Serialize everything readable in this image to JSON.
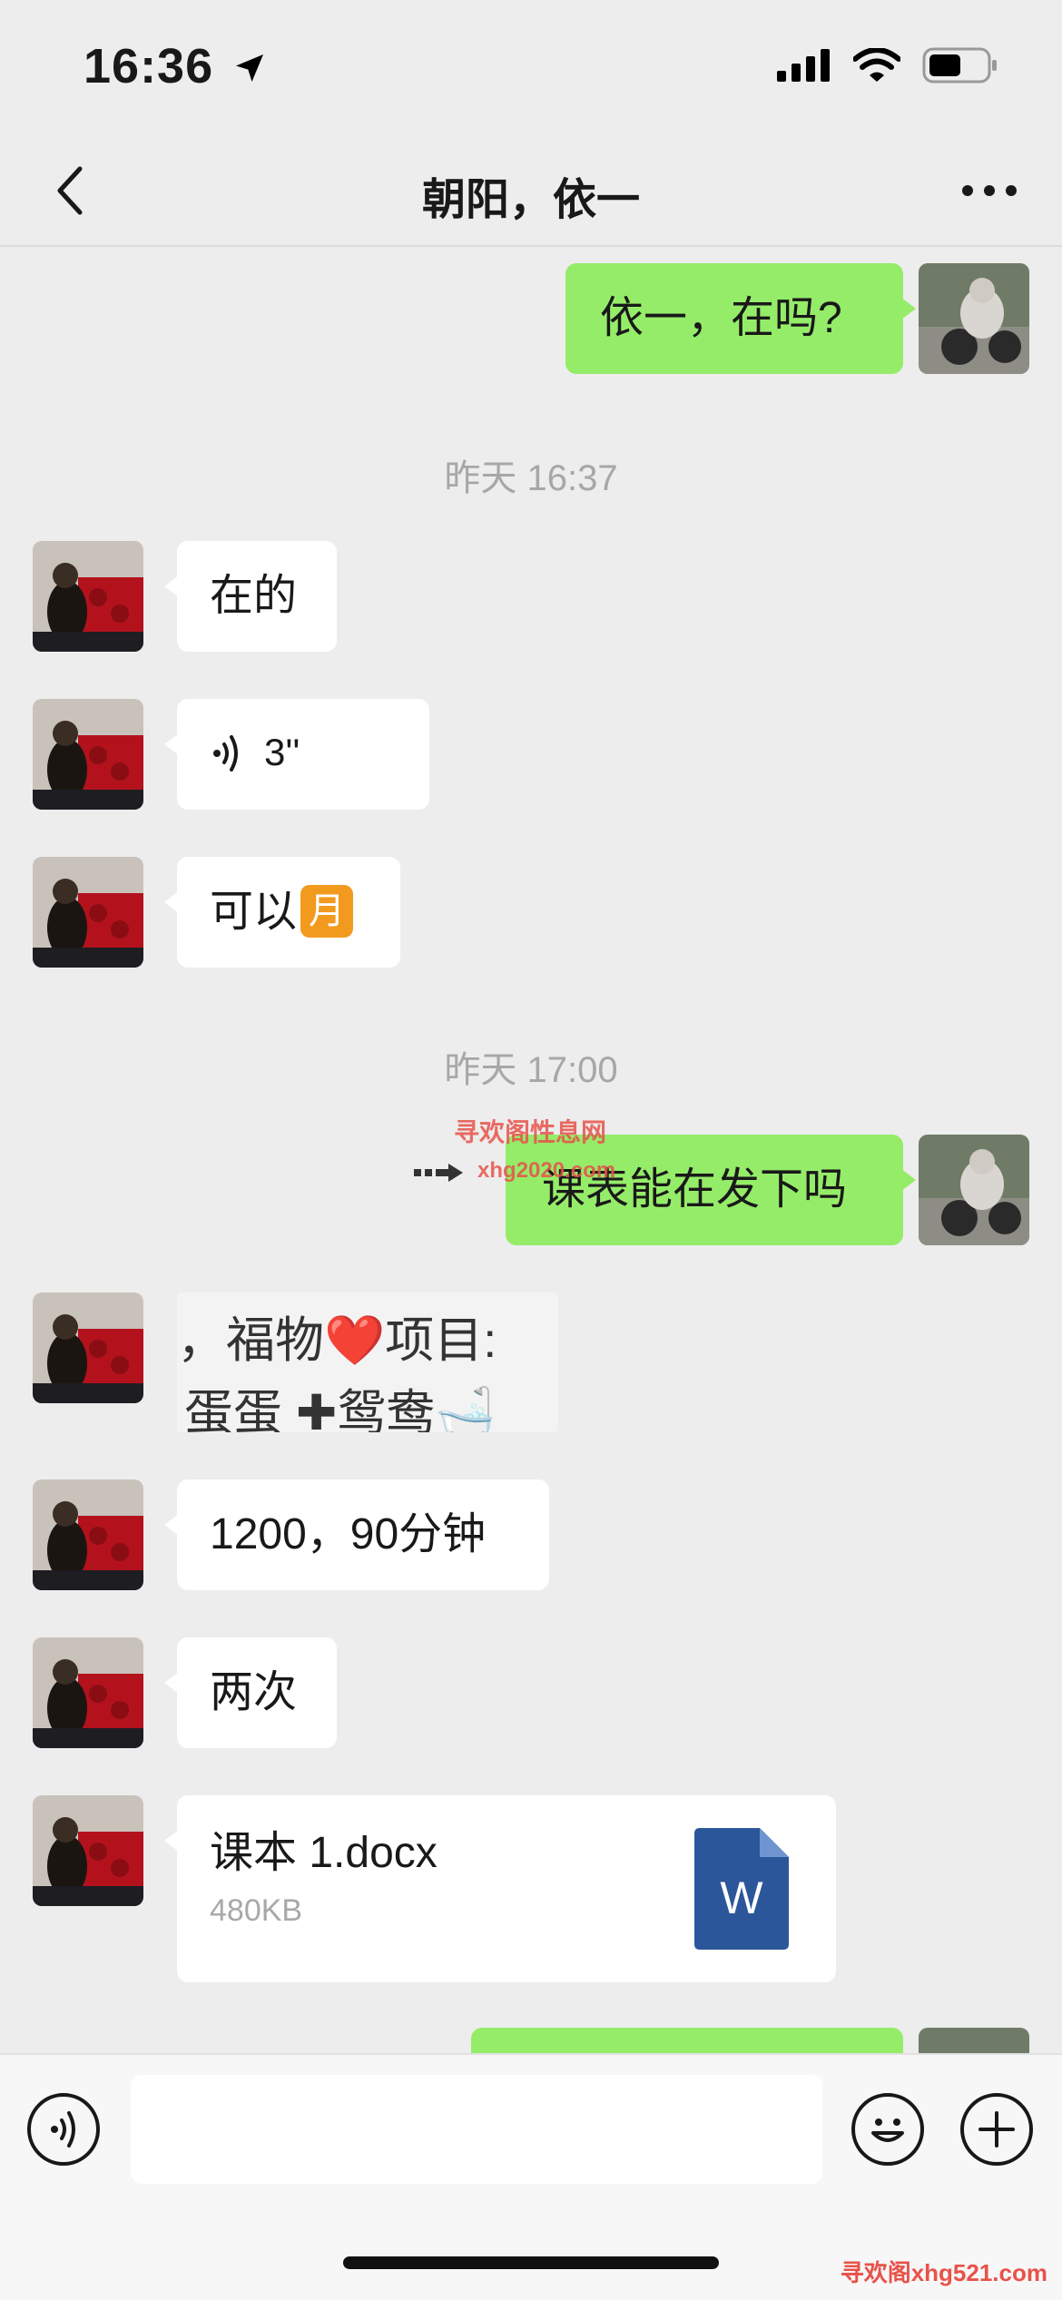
{
  "status_bar": {
    "time": "16:36"
  },
  "header": {
    "title": "朝阳，依一"
  },
  "messages": {
    "m1": "依一，在吗?",
    "ts1": "昨天 16:37",
    "m2": "在的",
    "m3_voice": "3''",
    "m4": "可以",
    "m4_emoji": "月",
    "ts2": "昨天 17:00",
    "m5": "课表能在发下吗",
    "m6_image": {
      "line1": "，福物❤️项目:",
      "line2": "蛋蛋 ✚鸳鸯🛁"
    },
    "m7": "1200，90分钟",
    "m8": "两次",
    "m9_file": {
      "name": "课本 1.docx",
      "size": "480KB",
      "icon_letter": "W"
    }
  },
  "watermarks": {
    "top": "寻欢阁性息网",
    "mid": "xhg2020.com",
    "bottom": "寻欢阁xhg521.com"
  },
  "colors": {
    "sent_bubble": "#95ec69",
    "received_bubble": "#ffffff",
    "background": "#ededed",
    "word_icon": "#2b579a",
    "watermark": "#e8524a"
  },
  "icons": [
    "back-icon",
    "more-icon",
    "voice-icon",
    "emoji-icon",
    "plus-icon",
    "signal-icon",
    "wifi-icon",
    "battery-icon",
    "location-arrow-icon",
    "word-file-icon"
  ]
}
